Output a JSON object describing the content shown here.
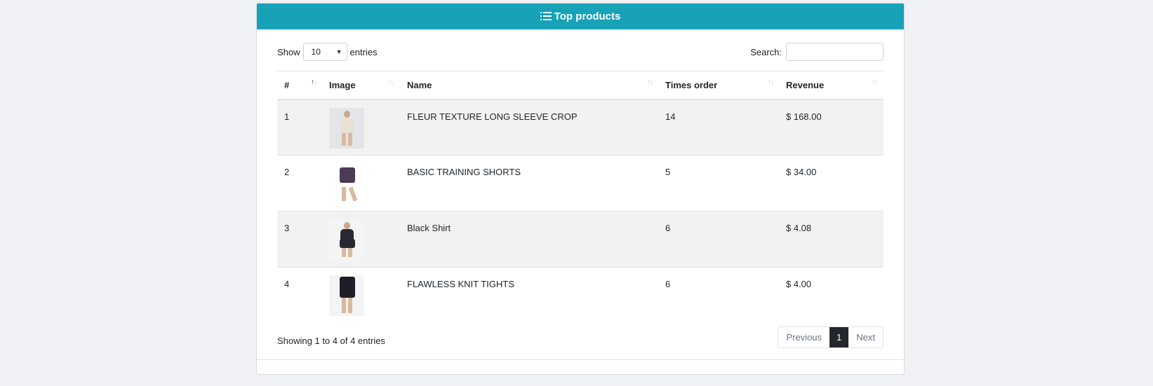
{
  "card": {
    "title": "Top products",
    "title_icon": "list-ol-icon"
  },
  "controls": {
    "show_label": "Show",
    "entries_value": "10",
    "entries_label": "entries",
    "search_label": "Search:",
    "search_value": "",
    "search_placeholder": ""
  },
  "table": {
    "columns": [
      "#",
      "Image",
      "Name",
      "Times order",
      "Revenue"
    ],
    "sorted_column": "#",
    "rows": [
      {
        "num": "1",
        "image": "product-photo-crop-top",
        "name": "FLEUR TEXTURE LONG SLEEVE CROP",
        "times": "14",
        "revenue": "$ 168.00"
      },
      {
        "num": "2",
        "image": "product-photo-training-shorts",
        "name": "BASIC TRAINING SHORTS",
        "times": "5",
        "revenue": "$ 34.00"
      },
      {
        "num": "3",
        "image": "product-photo-black-shirt",
        "name": "Black Shirt",
        "times": "6",
        "revenue": "$ 4.08"
      },
      {
        "num": "4",
        "image": "product-photo-knit-tights",
        "name": "FLAWLESS KNIT TIGHTS",
        "times": "6",
        "revenue": "$ 4.00"
      }
    ]
  },
  "footer": {
    "info": "Showing 1 to 4 of 4 entries",
    "prev_label": "Previous",
    "current_page": "1",
    "next_label": "Next"
  },
  "colors": {
    "header_bg": "#17a2b8",
    "page_bg": "#f0f1f5",
    "active_page_bg": "#23272b"
  }
}
